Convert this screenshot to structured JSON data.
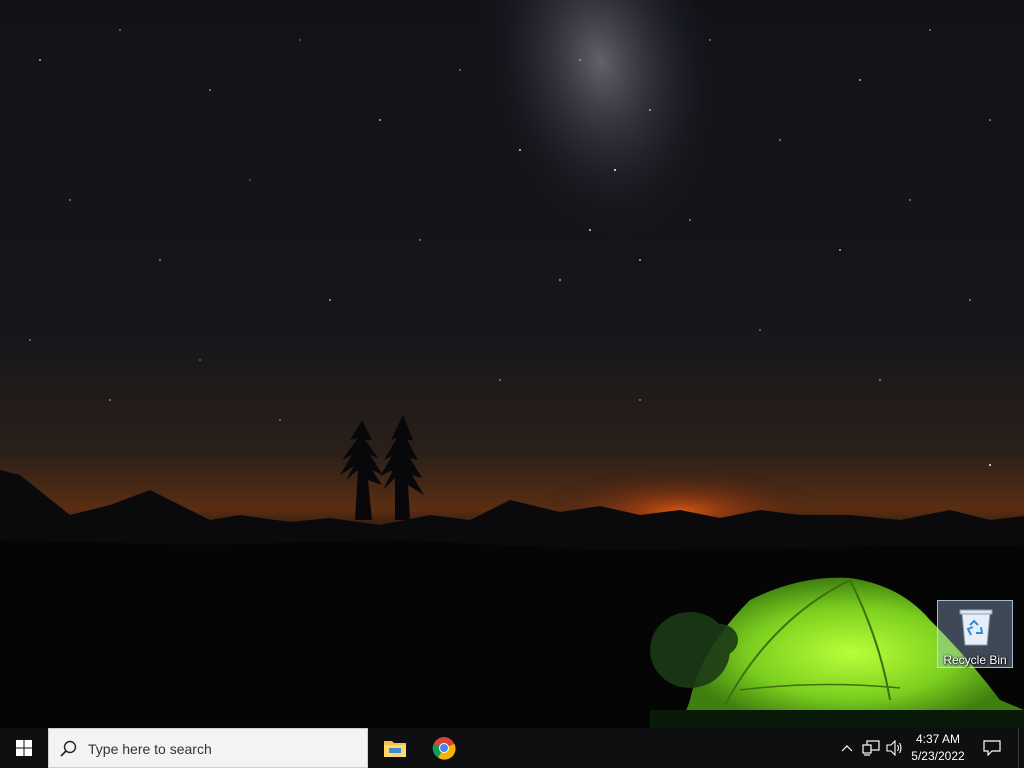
{
  "desktop": {
    "wallpaper": "night-sky-tent",
    "icons": [
      {
        "label": "Recycle Bin",
        "icon": "recycle-bin-icon"
      }
    ]
  },
  "taskbar": {
    "start_icon": "windows-logo-icon",
    "search": {
      "placeholder": "Type here to search",
      "icon": "search-icon"
    },
    "pinned_apps": [
      {
        "name": "File Explorer",
        "icon": "file-explorer-icon"
      },
      {
        "name": "Google Chrome",
        "icon": "chrome-icon"
      }
    ],
    "tray": {
      "icons": [
        "chevron-up-icon",
        "network-icon",
        "volume-icon"
      ],
      "time": "4:37 AM",
      "date": "5/23/2022",
      "notification_icon": "notification-icon"
    },
    "colors": {
      "background": "#0f0f12",
      "search_bg": "#f3f3f3"
    }
  }
}
